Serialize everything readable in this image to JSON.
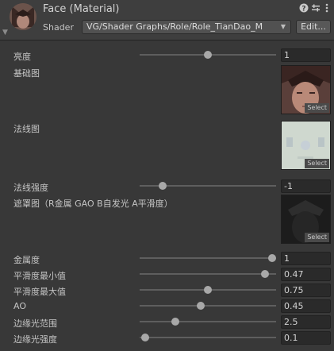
{
  "header": {
    "title": "Face (Material)",
    "shader_label": "Shader",
    "shader_value": "VG/Shader Graphs/Role/Role_TianDao_M",
    "edit_label": "Edit...",
    "icons": [
      "help-icon",
      "preset-icon",
      "more-icon"
    ]
  },
  "properties": [
    {
      "label": "亮度",
      "type": "slider",
      "value": "1",
      "level": 0.5
    },
    {
      "label": "基础图",
      "type": "texture",
      "select_label": "Select",
      "texture_icon": "face-albedo-texture"
    },
    {
      "label": "法线图",
      "type": "texture",
      "select_label": "Select",
      "texture_icon": "normal-map-texture"
    },
    {
      "label": "法线强度",
      "type": "slider",
      "value": "-1",
      "level": 0.17
    },
    {
      "label": "遮罩图（R金属 GAO B自发光 A平滑度）",
      "type": "texture",
      "select_label": "Select",
      "texture_icon": "mask-texture"
    },
    {
      "label": "金属度",
      "type": "slider",
      "value": "1",
      "level": 0.97
    },
    {
      "label": "平滑度最小值",
      "type": "slider",
      "value": "0.47",
      "level": 0.92
    },
    {
      "label": "平滑度最大值",
      "type": "slider",
      "value": "0.75",
      "level": 0.5
    },
    {
      "label": "AO",
      "type": "slider",
      "value": "0.45",
      "level": 0.45
    },
    {
      "label": "边缘光范围",
      "type": "slider",
      "value": "2.5",
      "level": 0.26
    },
    {
      "label": "边缘光强度",
      "type": "slider",
      "value": "0.1",
      "level": 0.04
    }
  ]
}
